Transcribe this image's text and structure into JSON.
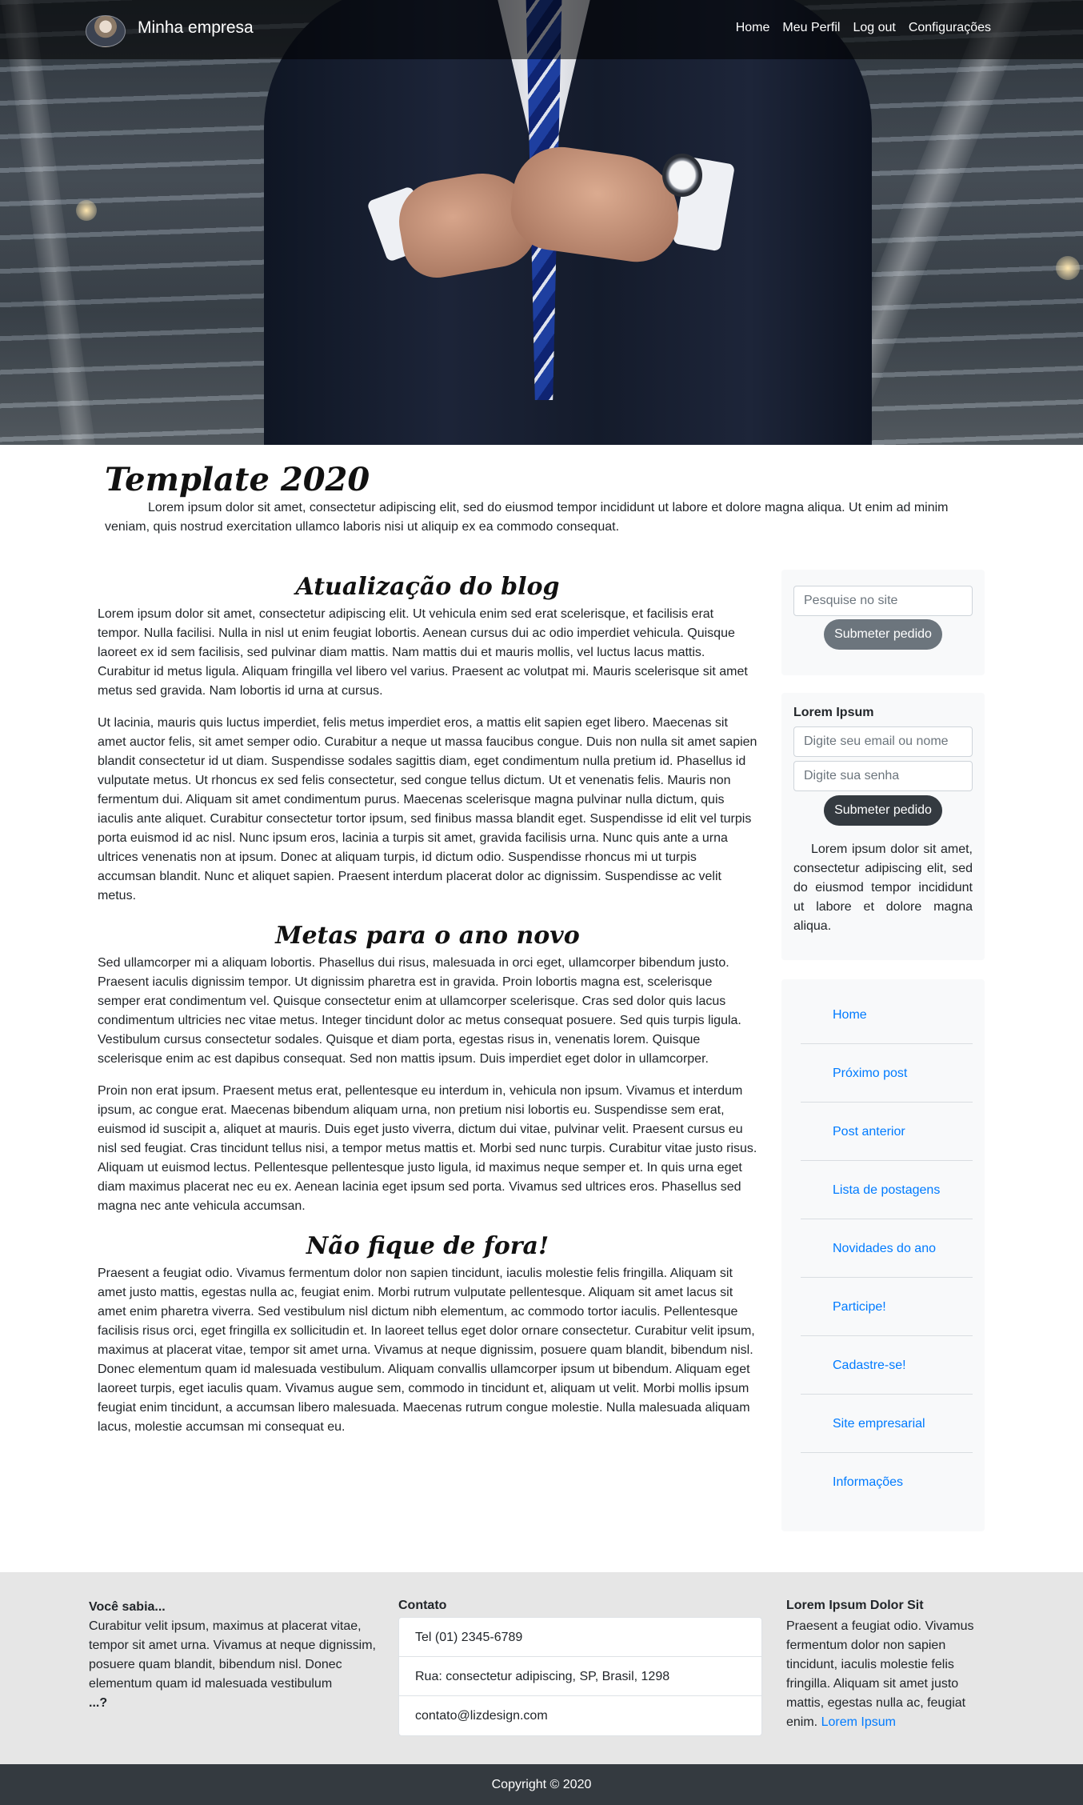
{
  "navbar": {
    "brand": "Minha empresa",
    "links": [
      "Home",
      "Meu Perfil",
      "Log out",
      "Configurações"
    ]
  },
  "header": {
    "title": "Template 2020",
    "intro": "Lorem ipsum dolor sit amet, consectetur adipiscing elit, sed do eiusmod tempor incididunt ut labore et dolore magna aliqua. Ut enim ad minim veniam, quis nostrud exercitation ullamco laboris nisi ut aliquip ex ea commodo consequat."
  },
  "main": {
    "sections": [
      {
        "title": "Atualização do blog",
        "paragraphs": [
          "Lorem ipsum dolor sit amet, consectetur adipiscing elit. Ut vehicula enim sed erat scelerisque, et facilisis erat tempor. Nulla facilisi. Nulla in nisl ut enim feugiat lobortis. Aenean cursus dui ac odio imperdiet vehicula. Quisque laoreet ex id sem facilisis, sed pulvinar diam mattis. Nam mattis dui et mauris mollis, vel luctus lacus mattis. Curabitur id metus ligula. Aliquam fringilla vel libero vel varius. Praesent ac volutpat mi. Mauris scelerisque sit amet metus sed gravida. Nam lobortis id urna at cursus.",
          "Ut lacinia, mauris quis luctus imperdiet, felis metus imperdiet eros, a mattis elit sapien eget libero. Maecenas sit amet auctor felis, sit amet semper odio. Curabitur a neque ut massa faucibus congue. Duis non nulla sit amet sapien blandit consectetur id ut diam. Suspendisse sodales sagittis diam, eget condimentum nulla pretium id. Phasellus id vulputate metus. Ut rhoncus ex sed felis consectetur, sed congue tellus dictum. Ut et venenatis felis. Mauris non fermentum dui. Aliquam sit amet condimentum purus. Maecenas scelerisque magna pulvinar nulla dictum, quis iaculis ante aliquet. Curabitur consectetur tortor ipsum, sed finibus massa blandit eget. Suspendisse id elit vel turpis porta euismod id ac nisl. Nunc ipsum eros, lacinia a turpis sit amet, gravida facilisis urna. Nunc quis ante a urna ultrices venenatis non at ipsum. Donec at aliquam turpis, id dictum odio. Suspendisse rhoncus mi ut turpis accumsan blandit. Nunc et aliquet sapien. Praesent interdum placerat dolor ac dignissim. Suspendisse ac velit metus."
        ]
      },
      {
        "title": "Metas para o ano novo",
        "paragraphs": [
          "Sed ullamcorper mi a aliquam lobortis. Phasellus dui risus, malesuada in orci eget, ullamcorper bibendum justo. Praesent iaculis dignissim tempor. Ut dignissim pharetra est in gravida. Proin lobortis magna est, scelerisque semper erat condimentum vel. Quisque consectetur enim at ullamcorper scelerisque. Cras sed dolor quis lacus condimentum ultricies nec vitae metus. Integer tincidunt dolor ac metus consequat posuere. Sed quis turpis ligula. Vestibulum cursus consectetur sodales. Quisque et diam porta, egestas risus in, venenatis lorem. Quisque scelerisque enim ac est dapibus consequat. Sed non mattis ipsum. Duis imperdiet eget dolor in ullamcorper.",
          "Proin non erat ipsum. Praesent metus erat, pellentesque eu interdum in, vehicula non ipsum. Vivamus et interdum ipsum, ac congue erat. Maecenas bibendum aliquam urna, non pretium nisi lobortis eu. Suspendisse sem erat, euismod id suscipit a, aliquet at mauris. Duis eget justo viverra, dictum dui vitae, pulvinar velit. Praesent cursus eu nisl sed feugiat. Cras tincidunt tellus nisi, a tempor metus mattis et. Morbi sed nunc turpis. Curabitur vitae justo risus. Aliquam ut euismod lectus. Pellentesque pellentesque justo ligula, id maximus neque semper et. In quis urna eget diam maximus placerat nec eu ex. Aenean lacinia eget ipsum sed porta. Vivamus sed ultrices eros. Phasellus sed magna nec ante vehicula accumsan."
        ]
      },
      {
        "title": "Não fique de fora!",
        "paragraphs": [
          "Praesent a feugiat odio. Vivamus fermentum dolor non sapien tincidunt, iaculis molestie felis fringilla. Aliquam sit amet justo mattis, egestas nulla ac, feugiat enim. Morbi rutrum vulputate pellentesque. Aliquam sit amet lacus sit amet enim pharetra viverra. Sed vestibulum nisl dictum nibh elementum, ac commodo tortor iaculis. Pellentesque facilisis risus orci, eget fringilla ex sollicitudin et. In laoreet tellus eget dolor ornare consectetur. Curabitur velit ipsum, maximus at placerat vitae, tempor sit amet urna. Vivamus at neque dignissim, posuere quam blandit, bibendum nisl. Donec elementum quam id malesuada vestibulum. Aliquam convallis ullamcorper ipsum ut bibendum. Aliquam eget laoreet turpis, eget iaculis quam. Vivamus augue sem, commodo in tincidunt et, aliquam ut velit. Morbi mollis ipsum feugiat enim tincidunt, a accumsan libero malesuada. Maecenas rutrum congue molestie. Nulla malesuada aliquam lacus, molestie accumsan mi consequat eu."
        ]
      }
    ]
  },
  "sidebar": {
    "search": {
      "placeholder": "Pesquise no site",
      "button": "Submeter pedido"
    },
    "login": {
      "title": "Lorem Ipsum",
      "user_placeholder": "Digite seu email ou nome",
      "password_placeholder": "Digite sua senha",
      "button": "Submeter pedido",
      "text": "Lorem ipsum dolor sit amet, consectetur adipiscing elit, sed do eiusmod tempor incididunt ut labore et dolore magna aliqua."
    },
    "links": [
      "Home",
      "Próximo post",
      "Post anterior",
      "Lista de postagens",
      "Novidades do ano",
      "Participe!",
      "Cadastre-se!",
      "Site empresarial",
      "Informações"
    ]
  },
  "footer": {
    "did_you_know": {
      "title": "Você sabia...",
      "text": "Curabitur velit ipsum, maximus at placerat vitae, tempor sit amet urna. Vivamus at neque dignissim, posuere quam blandit, bibendum nisl. Donec elementum quam id malesuada vestibulum",
      "ending": "...?"
    },
    "contact": {
      "title": "Contato",
      "items": [
        "Tel (01) 2345-6789",
        "Rua: consectetur adipiscing, SP, Brasil, 1298",
        "contato@lizdesign.com"
      ]
    },
    "about": {
      "title": "Lorem Ipsum Dolor Sit",
      "text": "Praesent a feugiat odio. Vivamus fermentum dolor non sapien tincidunt, iaculis molestie felis fringilla. Aliquam sit amet justo mattis, egestas nulla ac, feugiat enim.",
      "link": "Lorem Ipsum"
    },
    "copyright": "Copyright © 2020"
  },
  "colors": {
    "link": "#007bff",
    "footer_bg": "#e6e6e6",
    "copyright_bg": "#343a40",
    "sidebar_bg": "#f8f9fa"
  }
}
